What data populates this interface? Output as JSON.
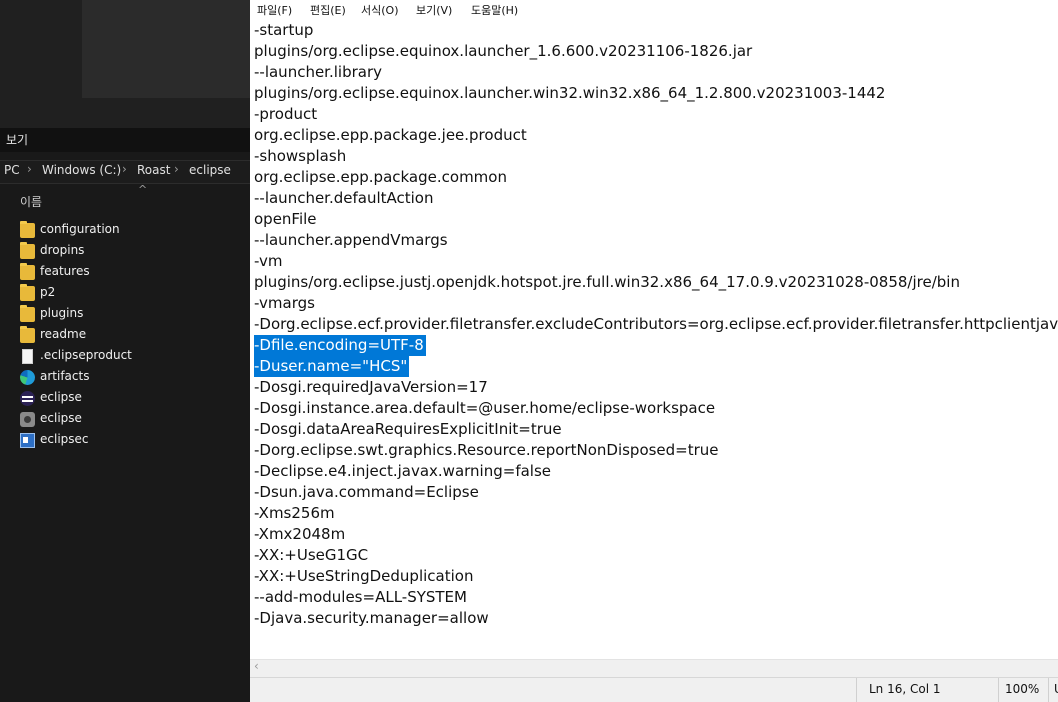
{
  "explorer": {
    "menu_view": "보기",
    "breadcrumb": [
      "PC",
      "Windows (C:)",
      "Roast",
      "eclipse"
    ],
    "column_name": "이름",
    "files": [
      {
        "name": "configuration",
        "icon": "folder-icon"
      },
      {
        "name": "dropins",
        "icon": "folder-icon"
      },
      {
        "name": "features",
        "icon": "folder-icon"
      },
      {
        "name": "p2",
        "icon": "folder-icon"
      },
      {
        "name": "plugins",
        "icon": "folder-icon"
      },
      {
        "name": "readme",
        "icon": "folder-icon"
      },
      {
        "name": ".eclipseproduct",
        "icon": "document-icon"
      },
      {
        "name": "artifacts",
        "icon": "edge-icon"
      },
      {
        "name": "eclipse",
        "icon": "eclipse-icon"
      },
      {
        "name": "eclipse",
        "icon": "settings-file-icon"
      },
      {
        "name": "eclipsec",
        "icon": "console-app-icon"
      }
    ]
  },
  "notepad": {
    "menu": [
      "파일(F)",
      "편집(E)",
      "서식(O)",
      "보기(V)",
      "도움말(H)"
    ],
    "lines": [
      "-startup",
      "plugins/org.eclipse.equinox.launcher_1.6.600.v20231106-1826.jar",
      "--launcher.library",
      "plugins/org.eclipse.equinox.launcher.win32.win32.x86_64_1.2.800.v20231003-1442",
      "-product",
      "org.eclipse.epp.package.jee.product",
      "-showsplash",
      "org.eclipse.epp.package.common",
      "--launcher.defaultAction",
      "openFile",
      "--launcher.appendVmargs",
      "-vm",
      "plugins/org.eclipse.justj.openjdk.hotspot.jre.full.win32.x86_64_17.0.9.v20231028-0858/jre/bin",
      "-vmargs",
      "-Dorg.eclipse.ecf.provider.filetransfer.excludeContributors=org.eclipse.ecf.provider.filetransfer.httpclientjava",
      "-Dfile.encoding=UTF-8",
      "-Duser.name=\"HCS\"",
      "-Dosgi.requiredJavaVersion=17",
      "-Dosgi.instance.area.default=@user.home/eclipse-workspace",
      "-Dosgi.dataAreaRequiresExplicitInit=true",
      "-Dorg.eclipse.swt.graphics.Resource.reportNonDisposed=true",
      "-Declipse.e4.inject.javax.warning=false",
      "-Dsun.java.command=Eclipse",
      "-Xms256m",
      "-Xmx2048m",
      "-XX:+UseG1GC",
      "-XX:+UseStringDeduplication",
      "--add-modules=ALL-SYSTEM",
      "-Djava.security.manager=allow"
    ],
    "selected_lines": [
      15,
      16
    ],
    "status": {
      "position": "Ln 16, Col 1",
      "zoom": "100%",
      "encoding": "U"
    },
    "colors": {
      "selection": "#0078d7"
    }
  }
}
